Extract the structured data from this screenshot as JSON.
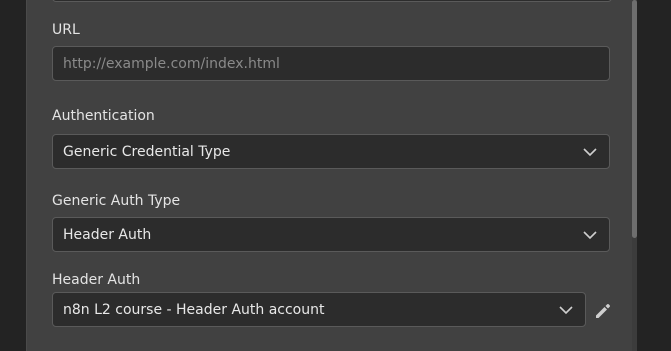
{
  "form": {
    "url": {
      "label": "URL",
      "placeholder": "http://example.com/index.html",
      "value": ""
    },
    "authentication": {
      "label": "Authentication",
      "selected": "Generic Credential Type"
    },
    "generic_auth_type": {
      "label": "Generic Auth Type",
      "selected": "Header Auth"
    },
    "header_auth": {
      "label": "Header Auth",
      "selected": "n8n L2 course - Header Auth account"
    }
  },
  "icons": {
    "dropdown": "chevron-down-icon",
    "edit": "pencil-icon"
  },
  "colors": {
    "panel_bg": "#414141",
    "input_bg": "#2c2c2c",
    "input_border": "#5a5a5a",
    "text": "#e8e8e8",
    "placeholder": "#8a8a8a"
  }
}
